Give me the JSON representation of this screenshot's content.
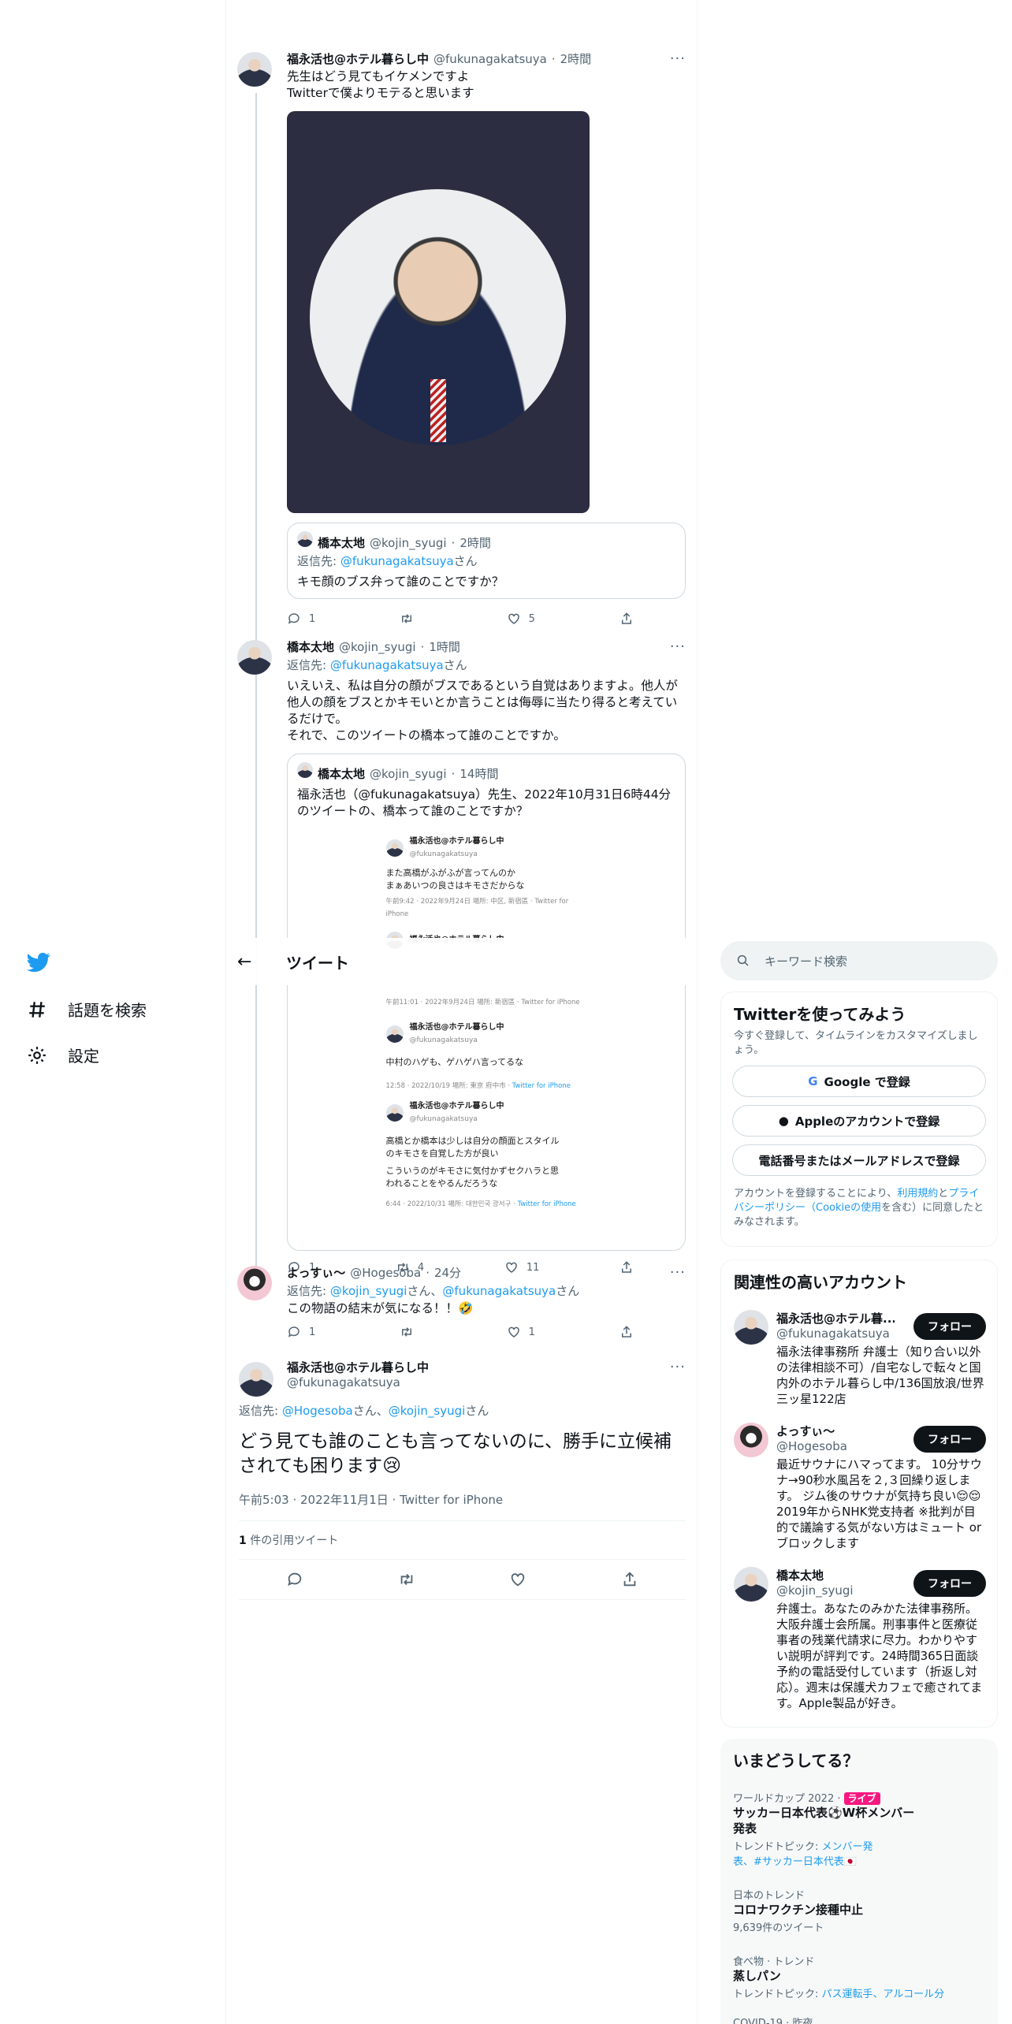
{
  "nav": {
    "search_label": "話題を検索",
    "settings_label": "設定"
  },
  "header": {
    "title": "ツイート"
  },
  "tweet1": {
    "name": "福永活也@ホテル暮らし中",
    "handle": "@fukunagakatsuya",
    "time": "2時間",
    "text1": "先生はどう見てもイケメンですよ",
    "text2": "Twitterで僕よりモテると思います",
    "quote": {
      "name": "橋本太地",
      "handle": "@kojin_syugi",
      "time": "2時間",
      "reply_prefix": "返信先: ",
      "reply_to": "@fukunagakatsuya",
      "reply_suffix": "さん",
      "text": "キモ顔のブス弁って誰のことですか？"
    },
    "replies": "1",
    "retweets": "",
    "likes": "5"
  },
  "tweet2": {
    "name": "橋本太地",
    "handle": "@kojin_syugi",
    "time": "1時間",
    "reply_prefix": "返信先: ",
    "reply_to": "@fukunagakatsuya",
    "reply_suffix": "さん",
    "text": "いえいえ、私は自分の顔がブスであるという自覚はありますよ。他人が他人の顔をブスとかキモいとか言うことは侮辱に当たり得ると考えているだけで。",
    "text2": "それで、このツイートの橋本って誰のことですか。",
    "quote": {
      "name": "橋本太地",
      "handle": "@kojin_syugi",
      "time": "14時間",
      "text": "福永活也（@fukunagakatsuya）先生、2022年10月31日6時44分のツイートの、橋本って誰のことですか？",
      "shot": {
        "n": "福永活也@ホテル暮らし中",
        "h": "@fukunagakatsuya",
        "t1a": "また高橋がふがふが言ってんのか",
        "t1b": "まぁあいつの良さはキモさだからな",
        "m1": "午前9:42 · 2022年9月24日 場所: 中区, 新宿區 · Twitter for iPhone",
        "m2": "午前11:01 · 2022年9月24日 場所: 新宿區 · Twitter for iPhone",
        "t3": "中村のハゲも、ゲハゲハ言ってるな",
        "m3": "12:58 · 2022/10/19 場所: 東京 府中市 · ",
        "m3b": "Twitter for iPhone",
        "t4a": "高橋とか橋本は少しは自分の顔面とスタイル",
        "t4b": "のキモさを自覚した方が良い",
        "t4c": "こういうのがキモさに気付かずセクハラと思",
        "t4d": "われることをやるんだろうな",
        "m4": "6:44 · 2022/10/31 場所: 대한민국 광서구 · ",
        "m4b": "Twitter for iPhone"
      }
    },
    "replies": "1",
    "retweets": "4",
    "likes": "11"
  },
  "tweet3": {
    "name": "よっすぃ〜",
    "handle": "@Hogesoba",
    "time": "24分",
    "reply_prefix": "返信先: ",
    "reply_to1": "@kojin_syugi",
    "mid": "さん、",
    "reply_to2": "@fukunagakatsuya",
    "reply_suffix": "さん",
    "text": "この物語の結末が気になる！！🤣",
    "replies": "1",
    "retweets": "",
    "likes": "1"
  },
  "main": {
    "name": "福永活也@ホテル暮らし中",
    "handle": "@fukunagakatsuya",
    "reply_prefix": "返信先: ",
    "reply_to1": "@Hogesoba",
    "mid": "さん、",
    "reply_to2": "@kojin_syugi",
    "reply_suffix": "さん",
    "text": "どう見ても誰のことも言ってないのに、勝手に立候補されても困ります😢",
    "meta": "午前5:03 · 2022年11月1日 · Twitter for iPhone",
    "quote_count": "1",
    "quote_label": " 件の引用ツイート"
  },
  "search": {
    "placeholder": "キーワード検索"
  },
  "signup": {
    "title": "Twitterを使ってみよう",
    "sub": "今すぐ登録して、タイムラインをカスタマイズしましょう。",
    "google": "Google で登録",
    "apple": "Appleのアカウントで登録",
    "phone": "電話番号またはメールアドレスで登録",
    "legal1": "アカウントを登録することにより、",
    "terms": "利用規約",
    "legal2": "と",
    "privacy": "プライバシーポリシー（Cookieの使用",
    "legal3": "を含む）に同意したとみなされます。"
  },
  "related": {
    "title": "関連性の高いアカウント",
    "follow": "フォロー",
    "accounts": [
      {
        "name": "福永活也@ホテル暮...",
        "handle": "@fukunagakatsuya",
        "bio": "福永法律事務所 弁護士（知り合い以外の法律相談不可）/自宅なしで転々と国内外のホテル暮らし中/136国放浪/世界三ッ星122店"
      },
      {
        "name": "よっすぃ〜",
        "handle": "@Hogesoba",
        "bio": "最近サウナにハマってます。 10分サウナ→90秒水風呂を２,３回繰り返します。 ジム後のサウナが気持ち良い😌😌 2019年からNHK党支持者 ※批判が目的で議論する気がない方はミュート or ブロックします"
      },
      {
        "name": "橋本太地",
        "handle": "@kojin_syugi",
        "bio": "弁護士。あなたのみかた法律事務所。大阪弁護士会所属。刑事事件と医療従事者の残業代請求に尽力。わかりやすい説明が評判です。24時間365日面談予約の電話受付しています（折返し対応）。週末は保護犬カフェで癒されてます。Apple製品が好き。"
      }
    ]
  },
  "trends": {
    "title": "いまどうしてる？",
    "items": [
      {
        "cat": "ワールドカップ 2022 · ",
        "live": "ライブ",
        "title1": "サッカー日本代表⚽️W杯メンバー",
        "title2": "発表",
        "sub_prefix": "トレンドトピック: ",
        "sub1": "メンバー発",
        "sub2": "表、#サッカー日本代表🇯🇵"
      },
      {
        "cat": "日本のトレンド",
        "title": "コロナワクチン接種中止",
        "sub": "9,639件のツイート"
      },
      {
        "cat": "食べ物 · トレンド",
        "title": "蒸しパン",
        "sub_prefix": "トレンドトピック: ",
        "sub1": "パス運転手、アルコール分"
      },
      {
        "cat": "COVID-19 · 昨夜"
      }
    ]
  }
}
